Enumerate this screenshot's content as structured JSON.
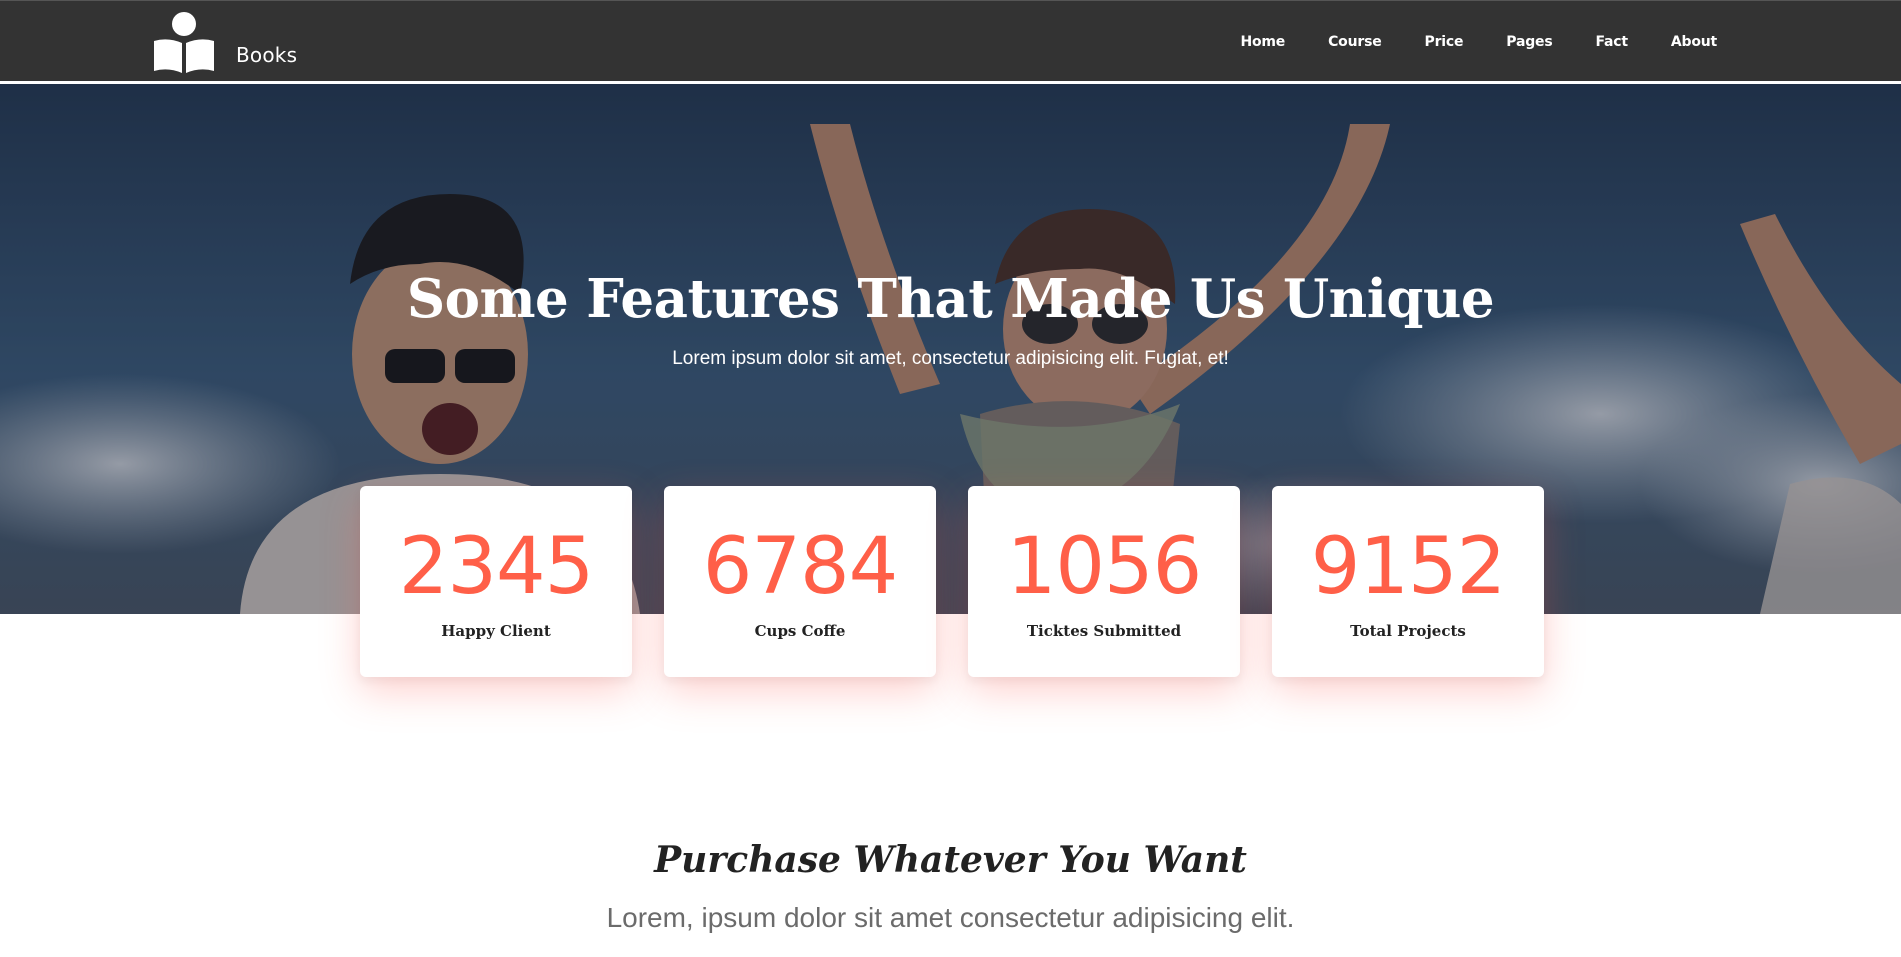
{
  "navbar": {
    "brand_name": "Books",
    "logo_icon": "open-book-reader-icon",
    "links": [
      "Home",
      "Course",
      "Price",
      "Pages",
      "Fact",
      "About"
    ]
  },
  "hero": {
    "title": "Some Features That Made Us Unique",
    "subtitle": "Lorem ipsum dolor sit amet, consectetur adipisicing elit. Fugiat, et!"
  },
  "stats": [
    {
      "number": "2345",
      "label": "Happy Client"
    },
    {
      "number": "6784",
      "label": "Cups Coffe"
    },
    {
      "number": "1056",
      "label": "Ticktes Submitted"
    },
    {
      "number": "9152",
      "label": "Total Projects"
    }
  ],
  "purchase": {
    "title": "Purchase Whatever You Want",
    "subtitle": "Lorem, ipsum dolor sit amet consectetur adipisicing elit."
  },
  "colors": {
    "accent": "#ff5f48",
    "navbar_bg": "#333333"
  }
}
